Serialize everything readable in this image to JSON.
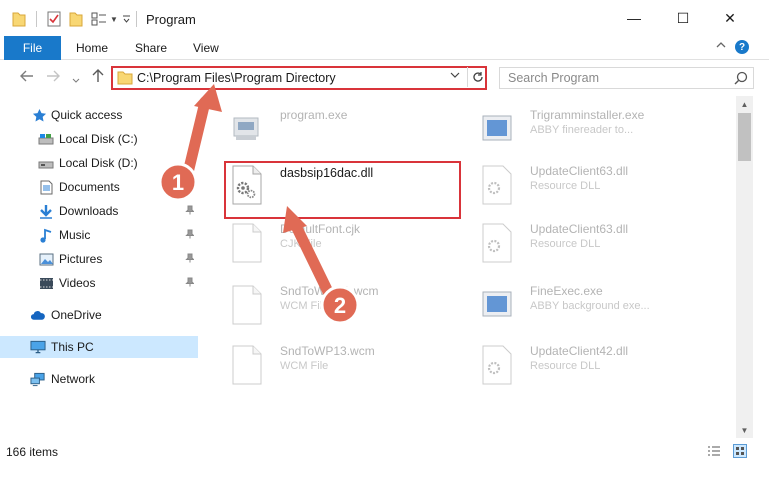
{
  "window": {
    "title": "Program",
    "controls": {
      "minimize": "—",
      "maximize": "☐",
      "close": "✕"
    }
  },
  "ribbon": {
    "file_label": "File",
    "tabs": [
      "Home",
      "Share",
      "View"
    ],
    "help_label": "?"
  },
  "address": {
    "path": "C:\\Program Files\\Program Directory",
    "search_placeholder": "Search Program"
  },
  "sidebar": {
    "items": [
      {
        "label": "Quick access",
        "icon": "star-icon",
        "pinned": false
      },
      {
        "label": "Local Disk (C:)",
        "icon": "drive-icon",
        "pinned": false
      },
      {
        "label": "Local Disk (D:)",
        "icon": "drive-icon",
        "pinned": false
      },
      {
        "label": "Documents",
        "icon": "documents-icon",
        "pinned": false
      },
      {
        "label": "Downloads",
        "icon": "download-icon",
        "pinned": true
      },
      {
        "label": "Music",
        "icon": "music-icon",
        "pinned": true
      },
      {
        "label": "Pictures",
        "icon": "pictures-icon",
        "pinned": true
      },
      {
        "label": "Videos",
        "icon": "videos-icon",
        "pinned": true
      },
      {
        "label": "OneDrive",
        "icon": "cloud-icon",
        "pinned": false
      },
      {
        "label": "This PC",
        "icon": "computer-icon",
        "pinned": false
      },
      {
        "label": "Network",
        "icon": "network-icon",
        "pinned": false
      }
    ]
  },
  "files": [
    {
      "name": "program.exe",
      "type": "",
      "icon": "exe-icon"
    },
    {
      "name": "Trigramminstaller.exe",
      "type": "ABBY finereader to...",
      "icon": "app-icon"
    },
    {
      "name": "dasbsip16dac.dll",
      "type": "",
      "icon": "dll-gear-icon"
    },
    {
      "name": "UpdateClient63.dll",
      "type": "Resource DLL",
      "icon": "dll-gear-icon"
    },
    {
      "name": "DefaultFont.cjk",
      "type": "CJK File",
      "icon": "file-icon"
    },
    {
      "name": "UpdateClient63.dll",
      "type": "Resource DLL",
      "icon": "dll-gear-icon"
    },
    {
      "name": "SndToWordA.wcm",
      "type": "WCM File",
      "icon": "file-icon"
    },
    {
      "name": "FineExec.exe",
      "type": "ABBY background exe...",
      "icon": "app-icon"
    },
    {
      "name": "SndToWP13.wcm",
      "type": "WCM File",
      "icon": "file-icon"
    },
    {
      "name": "UpdateClient42.dll",
      "type": "Resource DLL",
      "icon": "dll-gear-icon"
    }
  ],
  "status": {
    "item_count": "166 items"
  },
  "annotations": {
    "step1": "1",
    "step2": "2"
  }
}
